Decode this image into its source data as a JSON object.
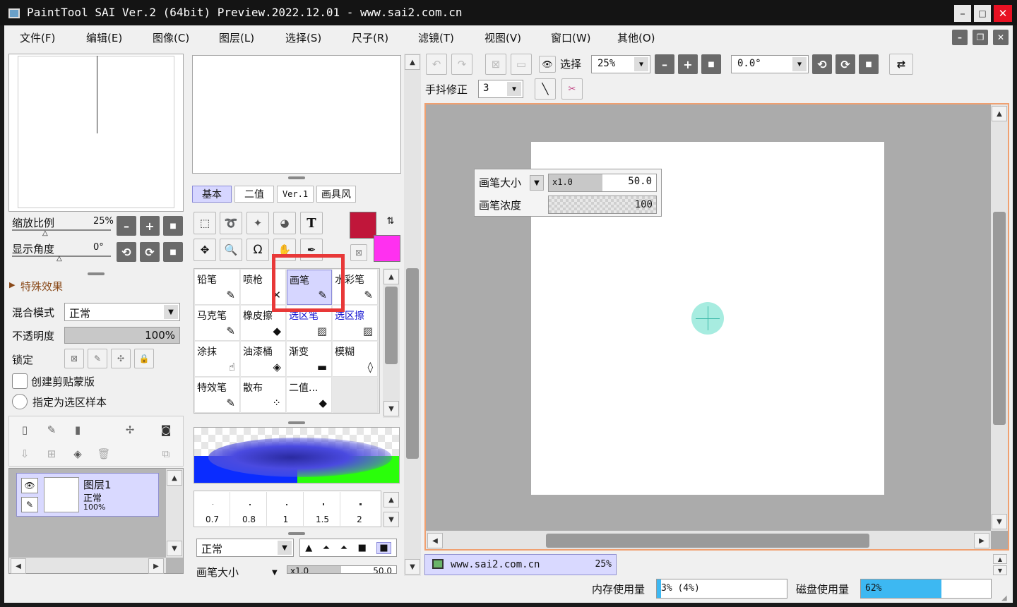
{
  "title": "PaintTool SAI Ver.2 (64bit) Preview.2022.12.01 - www.sai2.com.cn",
  "menu": [
    "文件(F)",
    "编辑(E)",
    "图像(C)",
    "图层(L)",
    "选择(S)",
    "尺子(R)",
    "滤镜(T)",
    "视图(V)",
    "窗口(W)",
    "其他(O)"
  ],
  "nav": {
    "zoom_label": "缩放比例",
    "zoom_value": "25%",
    "angle_label": "显示角度",
    "angle_value": "0°"
  },
  "effects": {
    "label": "特殊效果"
  },
  "layer_props": {
    "blend_label": "混合模式",
    "blend_value": "正常",
    "opacity_label": "不透明度",
    "opacity_value": "100%",
    "lock_label": "锁定",
    "clip_label": "创建剪贴蒙版",
    "sample_label": "指定为选区样本"
  },
  "layer": {
    "name": "图层1",
    "mode": "正常",
    "opacity": "100%"
  },
  "tool_tabs": [
    "基本",
    "二值",
    "Ver.1",
    "画具风"
  ],
  "colors": {
    "primary": "#c0163a",
    "secondary": "#ff30f0",
    "accent": "#3db8f2"
  },
  "tools": [
    {
      "name": "铅笔",
      "icon": "✎"
    },
    {
      "name": "喷枪",
      "icon": "✕"
    },
    {
      "name": "画笔",
      "icon": "✎"
    },
    {
      "name": "水彩笔",
      "icon": "✎"
    },
    {
      "name": "马克笔",
      "icon": "✎"
    },
    {
      "name": "橡皮擦",
      "icon": "◆"
    },
    {
      "name": "选区笔",
      "icon": "▨"
    },
    {
      "name": "选区擦",
      "icon": "▨"
    },
    {
      "name": "涂抹",
      "icon": "☝"
    },
    {
      "name": "油漆桶",
      "icon": "◈"
    },
    {
      "name": "渐变",
      "icon": "▬"
    },
    {
      "name": "模糊",
      "icon": "◊"
    },
    {
      "name": "特效笔",
      "icon": "✎"
    },
    {
      "name": "散布",
      "icon": "⁘"
    },
    {
      "name": "二值...",
      "icon": "◆"
    },
    {
      "name": "",
      "icon": ""
    }
  ],
  "brush_sizes": [
    "0.7",
    "0.8",
    "1",
    "1.5",
    "2"
  ],
  "brush_settings": {
    "blend": "正常",
    "size_label": "画笔大小",
    "size_mult": "x1.0",
    "size_value": "50.0",
    "density_label": "画笔浓度",
    "density_value": "100"
  },
  "toolbar": {
    "select_label": "选择",
    "zoom": "25%",
    "angle": "0.0°",
    "stabilizer_label": "手抖修正",
    "stabilizer_value": "3"
  },
  "canvas_tab": {
    "name": "www.sai2.com.cn",
    "zoom": "25%"
  },
  "status": {
    "mem_label": "内存使用量",
    "mem_value": "3% (4%)",
    "mem_level": 0.03,
    "disk_label": "磁盘使用量",
    "disk_value": "62%",
    "disk_level": 0.62
  }
}
